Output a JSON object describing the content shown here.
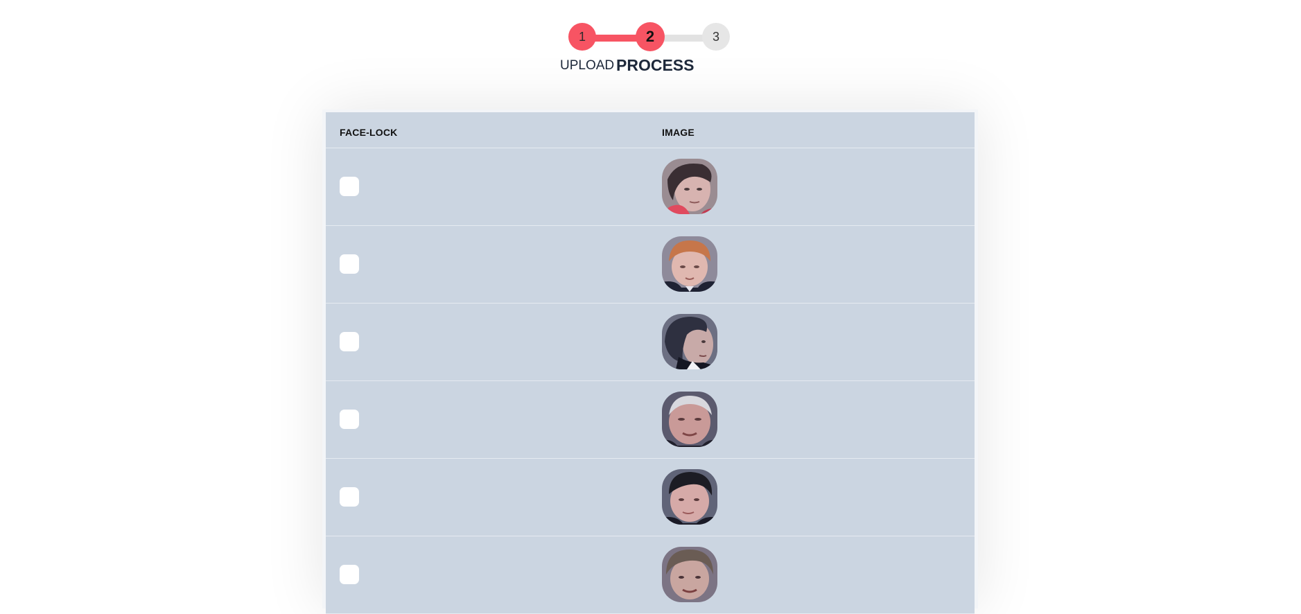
{
  "stepper": {
    "steps": [
      {
        "number": "1",
        "label": "UPLOAD",
        "state": "done"
      },
      {
        "number": "2",
        "label": "PROCESS",
        "state": "active"
      },
      {
        "number": "3",
        "label": "",
        "state": "pending"
      }
    ],
    "colors": {
      "active": "#f75463",
      "inactive": "#e2e2e2"
    }
  },
  "table": {
    "headers": {
      "face_lock": "FACE-LOCK",
      "image": "IMAGE"
    },
    "rows": [
      {
        "face_lock": false,
        "face": "face-thumbnail"
      },
      {
        "face_lock": false,
        "face": "face-thumbnail"
      },
      {
        "face_lock": false,
        "face": "face-thumbnail"
      },
      {
        "face_lock": false,
        "face": "face-thumbnail"
      },
      {
        "face_lock": false,
        "face": "face-thumbnail"
      },
      {
        "face_lock": false,
        "face": "face-thumbnail"
      }
    ],
    "row_background": "#cbd5e1"
  }
}
